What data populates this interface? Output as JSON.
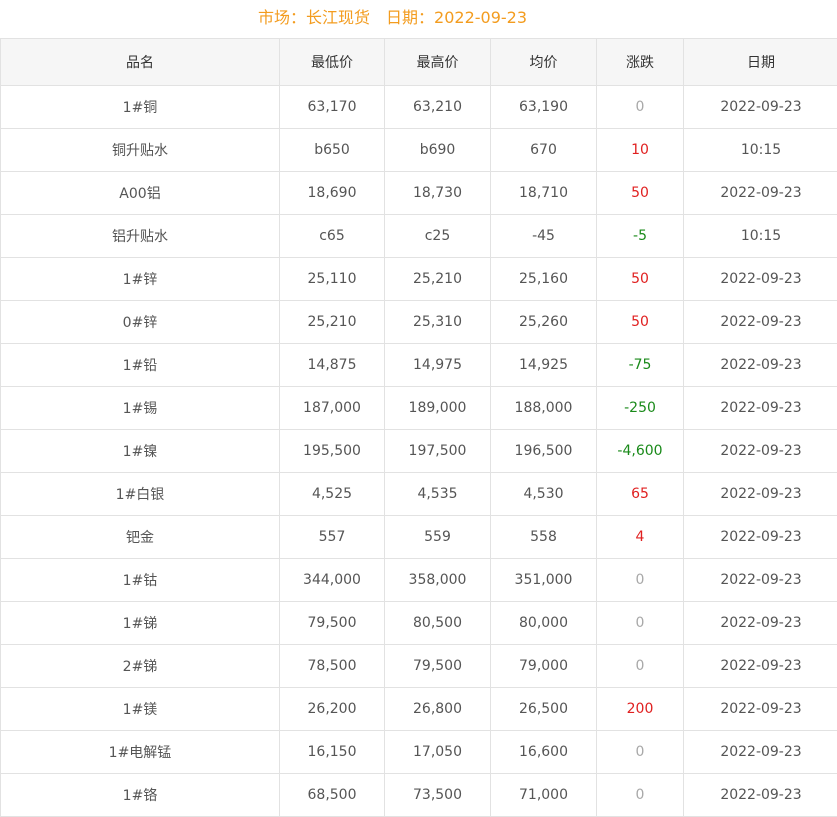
{
  "header": {
    "market_label": "市场：",
    "market": "长江现货",
    "date_label": "日期：",
    "date": "2022-09-23"
  },
  "colors": {
    "accent": "#f39c1f",
    "up": "#e02020",
    "down": "#1a8a1a",
    "flat": "#a8a8a8"
  },
  "table": {
    "columns": [
      "品名",
      "最低价",
      "最高价",
      "均价",
      "涨跌",
      "日期"
    ],
    "rows": [
      [
        "1#铜",
        "63,170",
        "63,210",
        "63,190",
        "0",
        "2022-09-23"
      ],
      [
        "铜升贴水",
        "b650",
        "b690",
        "670",
        "10",
        "10:15"
      ],
      [
        "A00铝",
        "18,690",
        "18,730",
        "18,710",
        "50",
        "2022-09-23"
      ],
      [
        "铝升贴水",
        "c65",
        "c25",
        "-45",
        "-5",
        "10:15"
      ],
      [
        "1#锌",
        "25,110",
        "25,210",
        "25,160",
        "50",
        "2022-09-23"
      ],
      [
        "0#锌",
        "25,210",
        "25,310",
        "25,260",
        "50",
        "2022-09-23"
      ],
      [
        "1#铅",
        "14,875",
        "14,975",
        "14,925",
        "-75",
        "2022-09-23"
      ],
      [
        "1#锡",
        "187,000",
        "189,000",
        "188,000",
        "-250",
        "2022-09-23"
      ],
      [
        "1#镍",
        "195,500",
        "197,500",
        "196,500",
        "-4,600",
        "2022-09-23"
      ],
      [
        "1#白银",
        "4,525",
        "4,535",
        "4,530",
        "65",
        "2022-09-23"
      ],
      [
        "钯金",
        "557",
        "559",
        "558",
        "4",
        "2022-09-23"
      ],
      [
        "1#钴",
        "344,000",
        "358,000",
        "351,000",
        "0",
        "2022-09-23"
      ],
      [
        "1#锑",
        "79,500",
        "80,500",
        "80,000",
        "0",
        "2022-09-23"
      ],
      [
        "2#锑",
        "78,500",
        "79,500",
        "79,000",
        "0",
        "2022-09-23"
      ],
      [
        "1#镁",
        "26,200",
        "26,800",
        "26,500",
        "200",
        "2022-09-23"
      ],
      [
        "1#电解锰",
        "16,150",
        "17,050",
        "16,600",
        "0",
        "2022-09-23"
      ],
      [
        "1#铬",
        "68,500",
        "73,500",
        "71,000",
        "0",
        "2022-09-23"
      ]
    ]
  }
}
